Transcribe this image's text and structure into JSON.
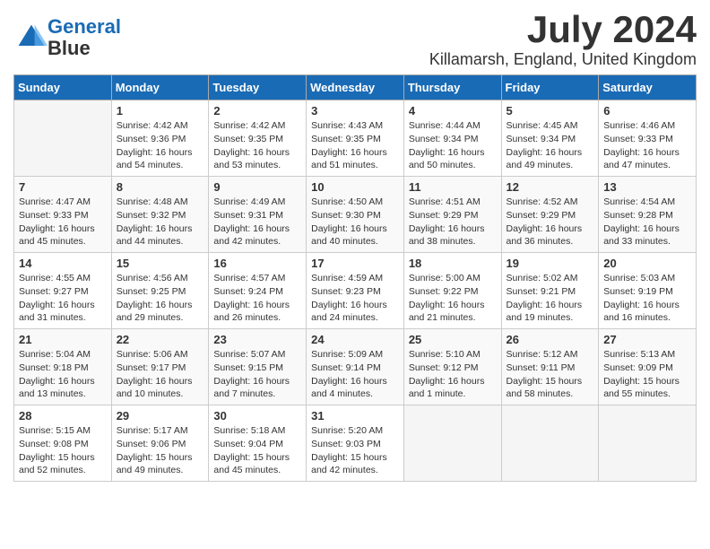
{
  "header": {
    "logo_line1": "General",
    "logo_line2": "Blue",
    "month": "July 2024",
    "location": "Killamarsh, England, United Kingdom"
  },
  "days_of_week": [
    "Sunday",
    "Monday",
    "Tuesday",
    "Wednesday",
    "Thursday",
    "Friday",
    "Saturday"
  ],
  "weeks": [
    [
      {
        "day": "",
        "sunrise": "",
        "sunset": "",
        "daylight": ""
      },
      {
        "day": "1",
        "sunrise": "Sunrise: 4:42 AM",
        "sunset": "Sunset: 9:36 PM",
        "daylight": "Daylight: 16 hours and 54 minutes."
      },
      {
        "day": "2",
        "sunrise": "Sunrise: 4:42 AM",
        "sunset": "Sunset: 9:35 PM",
        "daylight": "Daylight: 16 hours and 53 minutes."
      },
      {
        "day": "3",
        "sunrise": "Sunrise: 4:43 AM",
        "sunset": "Sunset: 9:35 PM",
        "daylight": "Daylight: 16 hours and 51 minutes."
      },
      {
        "day": "4",
        "sunrise": "Sunrise: 4:44 AM",
        "sunset": "Sunset: 9:34 PM",
        "daylight": "Daylight: 16 hours and 50 minutes."
      },
      {
        "day": "5",
        "sunrise": "Sunrise: 4:45 AM",
        "sunset": "Sunset: 9:34 PM",
        "daylight": "Daylight: 16 hours and 49 minutes."
      },
      {
        "day": "6",
        "sunrise": "Sunrise: 4:46 AM",
        "sunset": "Sunset: 9:33 PM",
        "daylight": "Daylight: 16 hours and 47 minutes."
      }
    ],
    [
      {
        "day": "7",
        "sunrise": "Sunrise: 4:47 AM",
        "sunset": "Sunset: 9:33 PM",
        "daylight": "Daylight: 16 hours and 45 minutes."
      },
      {
        "day": "8",
        "sunrise": "Sunrise: 4:48 AM",
        "sunset": "Sunset: 9:32 PM",
        "daylight": "Daylight: 16 hours and 44 minutes."
      },
      {
        "day": "9",
        "sunrise": "Sunrise: 4:49 AM",
        "sunset": "Sunset: 9:31 PM",
        "daylight": "Daylight: 16 hours and 42 minutes."
      },
      {
        "day": "10",
        "sunrise": "Sunrise: 4:50 AM",
        "sunset": "Sunset: 9:30 PM",
        "daylight": "Daylight: 16 hours and 40 minutes."
      },
      {
        "day": "11",
        "sunrise": "Sunrise: 4:51 AM",
        "sunset": "Sunset: 9:29 PM",
        "daylight": "Daylight: 16 hours and 38 minutes."
      },
      {
        "day": "12",
        "sunrise": "Sunrise: 4:52 AM",
        "sunset": "Sunset: 9:29 PM",
        "daylight": "Daylight: 16 hours and 36 minutes."
      },
      {
        "day": "13",
        "sunrise": "Sunrise: 4:54 AM",
        "sunset": "Sunset: 9:28 PM",
        "daylight": "Daylight: 16 hours and 33 minutes."
      }
    ],
    [
      {
        "day": "14",
        "sunrise": "Sunrise: 4:55 AM",
        "sunset": "Sunset: 9:27 PM",
        "daylight": "Daylight: 16 hours and 31 minutes."
      },
      {
        "day": "15",
        "sunrise": "Sunrise: 4:56 AM",
        "sunset": "Sunset: 9:25 PM",
        "daylight": "Daylight: 16 hours and 29 minutes."
      },
      {
        "day": "16",
        "sunrise": "Sunrise: 4:57 AM",
        "sunset": "Sunset: 9:24 PM",
        "daylight": "Daylight: 16 hours and 26 minutes."
      },
      {
        "day": "17",
        "sunrise": "Sunrise: 4:59 AM",
        "sunset": "Sunset: 9:23 PM",
        "daylight": "Daylight: 16 hours and 24 minutes."
      },
      {
        "day": "18",
        "sunrise": "Sunrise: 5:00 AM",
        "sunset": "Sunset: 9:22 PM",
        "daylight": "Daylight: 16 hours and 21 minutes."
      },
      {
        "day": "19",
        "sunrise": "Sunrise: 5:02 AM",
        "sunset": "Sunset: 9:21 PM",
        "daylight": "Daylight: 16 hours and 19 minutes."
      },
      {
        "day": "20",
        "sunrise": "Sunrise: 5:03 AM",
        "sunset": "Sunset: 9:19 PM",
        "daylight": "Daylight: 16 hours and 16 minutes."
      }
    ],
    [
      {
        "day": "21",
        "sunrise": "Sunrise: 5:04 AM",
        "sunset": "Sunset: 9:18 PM",
        "daylight": "Daylight: 16 hours and 13 minutes."
      },
      {
        "day": "22",
        "sunrise": "Sunrise: 5:06 AM",
        "sunset": "Sunset: 9:17 PM",
        "daylight": "Daylight: 16 hours and 10 minutes."
      },
      {
        "day": "23",
        "sunrise": "Sunrise: 5:07 AM",
        "sunset": "Sunset: 9:15 PM",
        "daylight": "Daylight: 16 hours and 7 minutes."
      },
      {
        "day": "24",
        "sunrise": "Sunrise: 5:09 AM",
        "sunset": "Sunset: 9:14 PM",
        "daylight": "Daylight: 16 hours and 4 minutes."
      },
      {
        "day": "25",
        "sunrise": "Sunrise: 5:10 AM",
        "sunset": "Sunset: 9:12 PM",
        "daylight": "Daylight: 16 hours and 1 minute."
      },
      {
        "day": "26",
        "sunrise": "Sunrise: 5:12 AM",
        "sunset": "Sunset: 9:11 PM",
        "daylight": "Daylight: 15 hours and 58 minutes."
      },
      {
        "day": "27",
        "sunrise": "Sunrise: 5:13 AM",
        "sunset": "Sunset: 9:09 PM",
        "daylight": "Daylight: 15 hours and 55 minutes."
      }
    ],
    [
      {
        "day": "28",
        "sunrise": "Sunrise: 5:15 AM",
        "sunset": "Sunset: 9:08 PM",
        "daylight": "Daylight: 15 hours and 52 minutes."
      },
      {
        "day": "29",
        "sunrise": "Sunrise: 5:17 AM",
        "sunset": "Sunset: 9:06 PM",
        "daylight": "Daylight: 15 hours and 49 minutes."
      },
      {
        "day": "30",
        "sunrise": "Sunrise: 5:18 AM",
        "sunset": "Sunset: 9:04 PM",
        "daylight": "Daylight: 15 hours and 45 minutes."
      },
      {
        "day": "31",
        "sunrise": "Sunrise: 5:20 AM",
        "sunset": "Sunset: 9:03 PM",
        "daylight": "Daylight: 15 hours and 42 minutes."
      },
      {
        "day": "",
        "sunrise": "",
        "sunset": "",
        "daylight": ""
      },
      {
        "day": "",
        "sunrise": "",
        "sunset": "",
        "daylight": ""
      },
      {
        "day": "",
        "sunrise": "",
        "sunset": "",
        "daylight": ""
      }
    ]
  ]
}
